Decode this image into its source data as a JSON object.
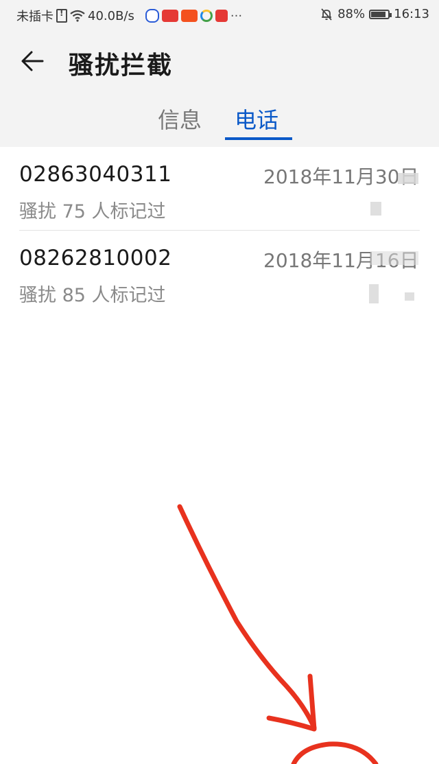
{
  "status_bar": {
    "carrier": "未插卡",
    "net_speed": "40.0B/s",
    "battery": "88%",
    "battery_level": 0.88,
    "time": "16:13",
    "more": "···",
    "icons": [
      "sim-alert-icon",
      "wifi-icon",
      "baidu-app-icon",
      "toutiao-app-icon",
      "kuaibao-app-icon",
      "circle-app-icon",
      "red-app-icon",
      "more-icon",
      "bell-off-icon",
      "battery-icon"
    ]
  },
  "header": {
    "title": "骚扰拦截",
    "back_icon": "back-arrow-icon"
  },
  "tabs": [
    {
      "label": "信息",
      "active": false
    },
    {
      "label": "电话",
      "active": true
    }
  ],
  "colors": {
    "accent": "#0a59c8",
    "annotation": "#e8321e"
  },
  "calls": [
    {
      "number": "02863040311",
      "date": "2018年11月30日",
      "tag": "骚扰  75 人标记过"
    },
    {
      "number": "08262810002",
      "date": "2018年11月16日",
      "tag": "骚扰  85 人标记过"
    }
  ]
}
